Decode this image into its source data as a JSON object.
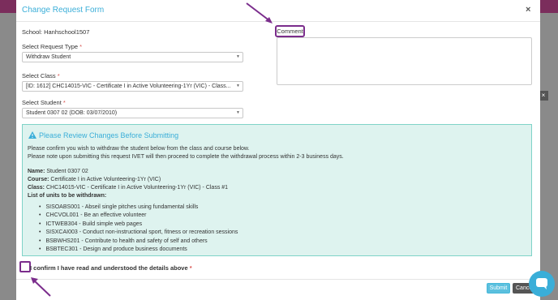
{
  "modal": {
    "title": "Change Request Form",
    "close_glyph": "×"
  },
  "form": {
    "school": "School: Hanhschool1507",
    "request_type": {
      "label": "Select Request Type",
      "required": "*",
      "value": "Withdraw Student"
    },
    "class": {
      "label": "Select Class",
      "required": "*",
      "value": "[ID: 1612] CHC14015-VIC - Certificate I in Active Volunteering-1Yr (VIC) - Class..."
    },
    "student": {
      "label": "Select Student",
      "required": "*",
      "value": "Student 0307 02 (DOB: 03/07/2010)"
    },
    "comment": {
      "label": "Comment",
      "value": ""
    }
  },
  "alert": {
    "title": "Please Review Changes Before Submitting",
    "line1": "Please confirm you wish to withdraw the student below from the class and course below.",
    "line2": "Please note upon submitting this request IVET will then proceed to complete the withdrawal process within 2-3 business days.",
    "name_label": "Name:",
    "name_value": "Student 0307 02",
    "course_label": "Course:",
    "course_value": "Certificate I in Active Volunteering-1Yr (VIC)",
    "class_label": "Class:",
    "class_value": "CHC14015-VIC - Certificate I in Active Volunteering-1Yr (VIC) - Class #1",
    "units_label": "List of units to be withdrawn:",
    "units": [
      "SISOABS001 - Abseil single pitches using fundamental skills",
      "CHCVOL001 - Be an effective volunteer",
      "ICTWEB304 - Build simple web pages",
      "SISXCAI003 - Conduct non-instructional sport, fitness or recreation sessions",
      "BSBWHS201 - Contribute to health and safety of self and others",
      "BSBTEC301 - Design and produce business documents"
    ]
  },
  "confirm": {
    "label": "I confirm I have read and understood the details above",
    "required": "*"
  },
  "footer": {
    "submit": "Submit",
    "cancel": "Cancel"
  },
  "colors": {
    "accent": "#3aaed8",
    "highlight": "#7b2d8c",
    "alert_bg": "#def3ef"
  }
}
